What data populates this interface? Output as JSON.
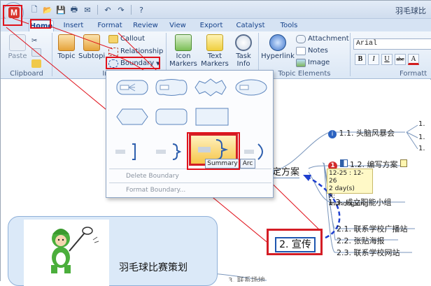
{
  "window": {
    "title": "羽毛球比"
  },
  "logo": {
    "letter": "M"
  },
  "quick_access": [
    "new-icon",
    "open-icon",
    "save-icon",
    "print-icon",
    "send-icon",
    "undo-icon",
    "redo-icon",
    "help-icon"
  ],
  "tabs": [
    {
      "label": "Home",
      "active": true
    },
    {
      "label": "Insert"
    },
    {
      "label": "Format"
    },
    {
      "label": "Review"
    },
    {
      "label": "View"
    },
    {
      "label": "Export"
    },
    {
      "label": "Catalyst"
    },
    {
      "label": "Tools"
    }
  ],
  "ribbon": {
    "paste_label": "Paste",
    "clipboard_label": "Clipboard",
    "topic_label": "Topic",
    "subtopic_label": "Subtopi",
    "insert_group_label": "In",
    "callout_label": "Callout",
    "relationship_label": "Relationship",
    "boundary_label": "Boundary",
    "icon_markers_label": "Icon\nMarkers",
    "text_markers_label": "Text\nMarkers",
    "task_info_label": "Task\nInfo",
    "hyperlink_label": "Hyperlink",
    "attachment_label": "Attachment",
    "notes_label": "Notes",
    "image_label": "Image",
    "topic_elements_label": "Topic Elements",
    "font_value": "Arial",
    "format_label": "Formatt",
    "bold": "B",
    "italic": "I",
    "underline": "U",
    "strike": "abc",
    "font_color": "A"
  },
  "dropdown": {
    "delete_boundary": "Delete Boundary",
    "format_boundary": "Format Boundary...",
    "summary_tip": "Summary",
    "arc_tip": "Arc"
  },
  "mindmap": {
    "node_1_1": "1.1. 头脑风暴会",
    "node_1_2": "1.2. 编写方案",
    "node_1_3": "1.3. 成立职能小组",
    "partial_topic": "定方案",
    "selected_topic": "2. 宣传",
    "node_2_1": "2.1. 联系学校广播站",
    "node_2_2": "2.2. 张贴海报",
    "node_2_3": "2.3. 联系学校网站",
    "node_bottom": "3. 联系场地",
    "central_title": "羽毛球比赛策划",
    "right_edge_1": "1.",
    "right_edge_2": "1.",
    "right_edge_3": "1.",
    "task_dates": "12-25 : 12-26",
    "task_duration": "2 day(s)",
    "task_resource": "R: muhongxing",
    "priority": "1"
  },
  "colors": {
    "annotation_red": "#e0121b",
    "link_blue": "#1e3fcf"
  }
}
